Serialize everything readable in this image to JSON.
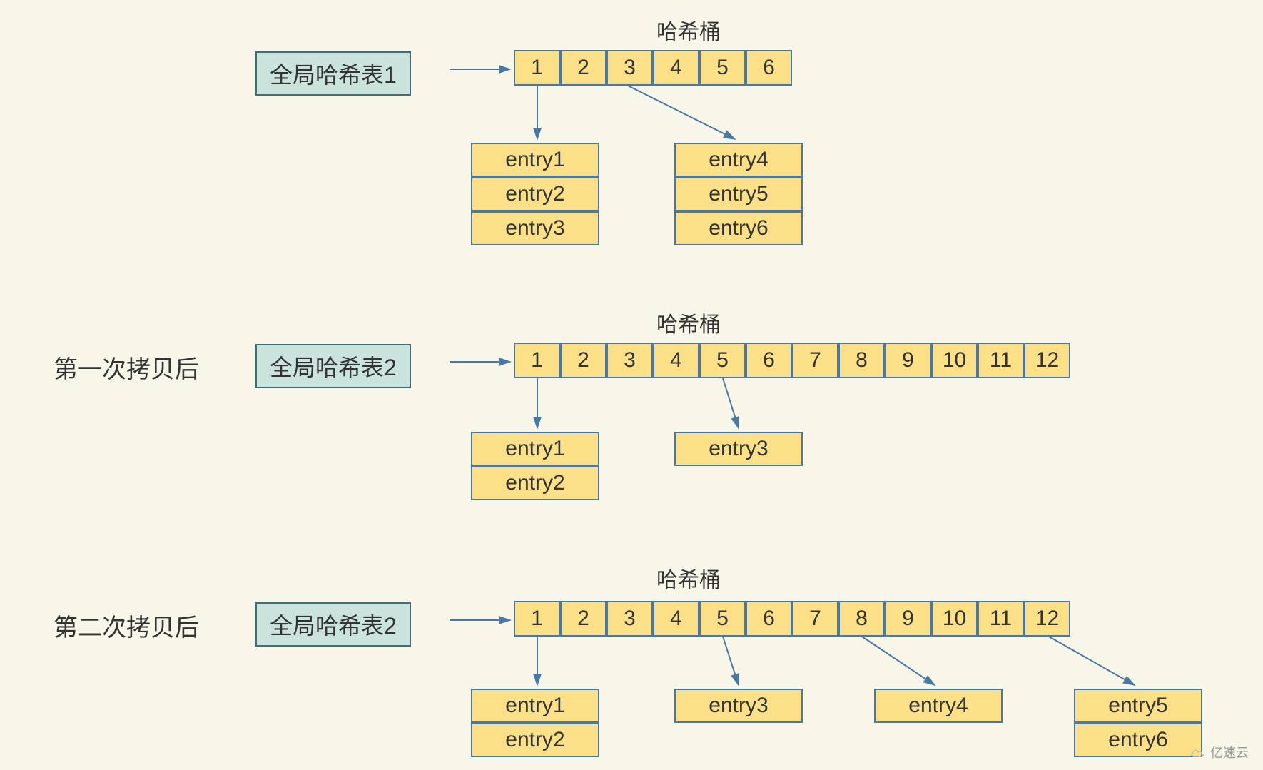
{
  "watermark": "亿速云",
  "bucket_label": "哈希桶",
  "sections": {
    "s1": {
      "phase_label": "",
      "table_box": "全局哈希表1",
      "buckets": [
        "1",
        "2",
        "3",
        "4",
        "5",
        "6"
      ],
      "entries": {
        "col1": [
          "entry1",
          "entry2",
          "entry3"
        ],
        "col2": [
          "entry4",
          "entry5",
          "entry6"
        ]
      }
    },
    "s2": {
      "phase_label": "第一次拷贝后",
      "table_box": "全局哈希表2",
      "buckets": [
        "1",
        "2",
        "3",
        "4",
        "5",
        "6",
        "7",
        "8",
        "9",
        "10",
        "11",
        "12"
      ],
      "entries": {
        "col1": [
          "entry1",
          "entry2"
        ],
        "col2": [
          "entry3"
        ]
      }
    },
    "s3": {
      "phase_label": "第二次拷贝后",
      "table_box": "全局哈希表2",
      "buckets": [
        "1",
        "2",
        "3",
        "4",
        "5",
        "6",
        "7",
        "8",
        "9",
        "10",
        "11",
        "12"
      ],
      "entries": {
        "col1": [
          "entry1",
          "entry2"
        ],
        "col2": [
          "entry3"
        ],
        "col3": [
          "entry4"
        ],
        "col4": [
          "entry5",
          "entry6"
        ]
      }
    }
  }
}
